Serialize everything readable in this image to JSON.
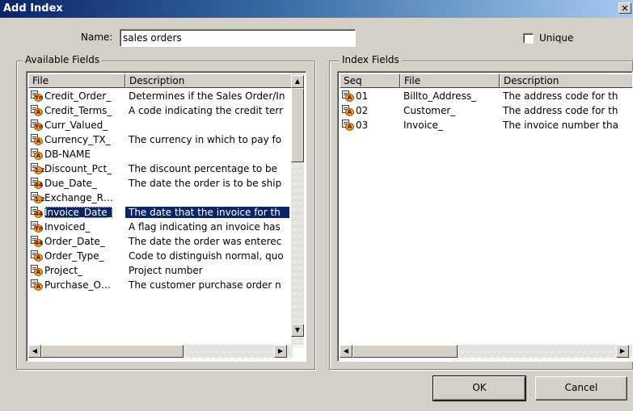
{
  "window": {
    "title": "Add Index",
    "close_glyph": "✕"
  },
  "name_field": {
    "label": "Name:",
    "value": "sales orders"
  },
  "unique": {
    "label": "Unique",
    "checked": false
  },
  "available": {
    "group_title": "Available Fields",
    "columns": [
      "File",
      "Description"
    ],
    "rows": [
      {
        "icon": "text-field-icon",
        "badge": "Yn",
        "file": "Credit_Order_",
        "desc": "Determines if the Sales Order/In"
      },
      {
        "icon": "text-field-icon",
        "badge": "A",
        "file": "Credit_Terms_",
        "desc": "A code indicating the credit terr"
      },
      {
        "icon": "text-field-icon",
        "badge": "Yn",
        "file": "Curr_Valued_",
        "desc": ""
      },
      {
        "icon": "text-field-icon",
        "badge": "A",
        "file": "Currency_TX_",
        "desc": "The currency in which to pay fo"
      },
      {
        "icon": "text-field-icon",
        "badge": "A",
        "file": "DB-NAME",
        "desc": ""
      },
      {
        "icon": "number-field-icon",
        "badge": "1.2",
        "file": "Discount_Pct_",
        "desc": "The discount percentage to be"
      },
      {
        "icon": "date-field-icon",
        "badge": "44",
        "file": "Due_Date_",
        "desc": "The date the order is to be ship"
      },
      {
        "icon": "number-field-icon",
        "badge": "1.2",
        "file": "Exchange_R…",
        "desc": ""
      },
      {
        "icon": "date-field-icon",
        "badge": "44",
        "file": "Invoice_Date_",
        "desc": "The date that the invoice for th",
        "selected": true
      },
      {
        "icon": "text-field-icon",
        "badge": "Yn",
        "file": "Invoiced_",
        "desc": "A flag indicating an invoice has"
      },
      {
        "icon": "date-field-icon",
        "badge": "44",
        "file": "Order_Date_",
        "desc": "The date the order was enterec"
      },
      {
        "icon": "text-field-icon",
        "badge": "A",
        "file": "Order_Type_",
        "desc": "Code to distinguish normal, quo"
      },
      {
        "icon": "text-field-icon",
        "badge": "A",
        "file": "Project_",
        "desc": "Project number"
      },
      {
        "icon": "text-field-icon",
        "badge": "A",
        "file": "Purchase_O…",
        "desc": "The customer purchase order n"
      }
    ]
  },
  "index_fields": {
    "group_title": "Index Fields",
    "columns": [
      "Seq",
      "File",
      "Description"
    ],
    "rows": [
      {
        "icon": "text-field-icon",
        "badge": "A",
        "seq": "01",
        "file": "Billto_Address_",
        "desc": "The address code for th"
      },
      {
        "icon": "text-field-icon",
        "badge": "A",
        "seq": "02",
        "file": "Customer_",
        "desc": "The address code for th"
      },
      {
        "icon": "text-field-icon",
        "badge": "A",
        "seq": "03",
        "file": "Invoice_",
        "desc": "The invoice number tha"
      }
    ]
  },
  "buttons": {
    "ok": "OK",
    "cancel": "Cancel"
  },
  "scroll_glyphs": {
    "up": "▲",
    "down": "▼",
    "left": "◀",
    "right": "▶"
  },
  "colors": {
    "title_start": "#0a246a",
    "title_end": "#a6caf0",
    "selection": "#0a246a",
    "face": "#d4d0c8"
  }
}
